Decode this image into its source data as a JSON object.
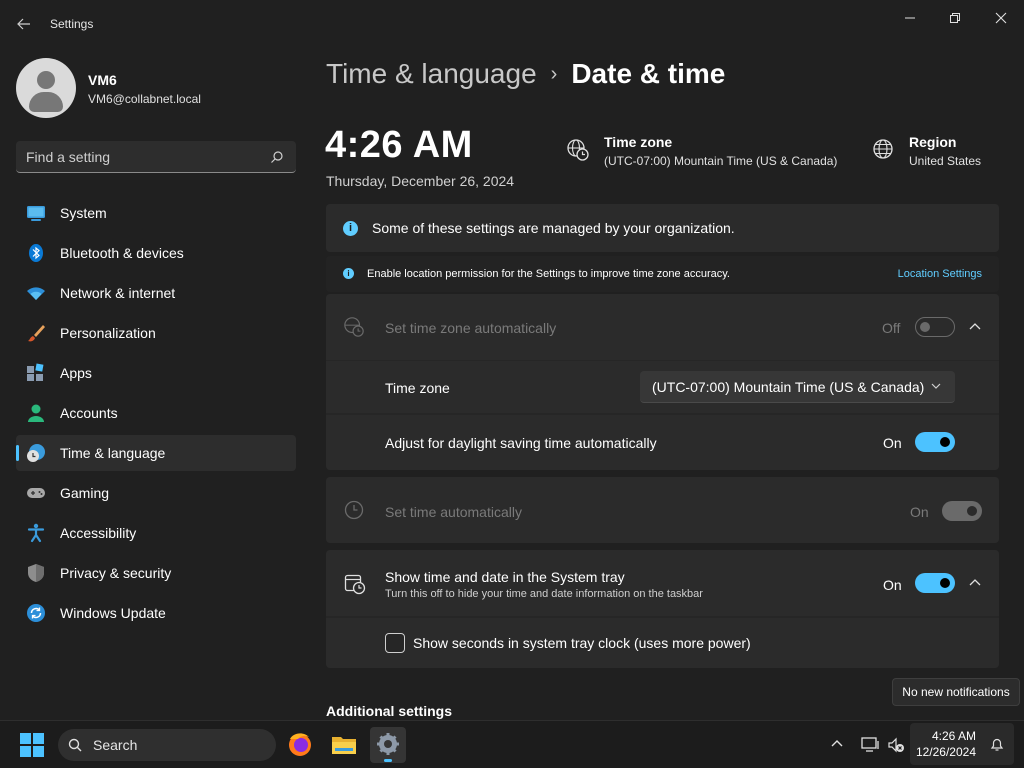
{
  "window": {
    "app_title": "Settings",
    "back_icon": "back-arrow-icon",
    "controls": [
      "minimize-icon",
      "restore-icon",
      "close-icon"
    ]
  },
  "profile": {
    "name": "VM6",
    "email": "VM6@collabnet.local"
  },
  "find": {
    "placeholder": "Find a setting"
  },
  "nav": {
    "items": [
      {
        "label": "System",
        "icon": "system-icon"
      },
      {
        "label": "Bluetooth & devices",
        "icon": "bluetooth-icon"
      },
      {
        "label": "Network & internet",
        "icon": "wifi-icon"
      },
      {
        "label": "Personalization",
        "icon": "brush-icon"
      },
      {
        "label": "Apps",
        "icon": "apps-icon"
      },
      {
        "label": "Accounts",
        "icon": "accounts-icon"
      },
      {
        "label": "Time & language",
        "icon": "time-language-icon",
        "active": true
      },
      {
        "label": "Gaming",
        "icon": "gamepad-icon"
      },
      {
        "label": "Accessibility",
        "icon": "accessibility-icon"
      },
      {
        "label": "Privacy & security",
        "icon": "shield-icon"
      },
      {
        "label": "Windows Update",
        "icon": "update-icon"
      }
    ]
  },
  "page": {
    "breadcrumb_parent": "Time & language",
    "breadcrumb_sep": "›",
    "breadcrumb_current": "Date & time"
  },
  "clock": {
    "time": "4:26 AM",
    "date": "Thursday, December 26, 2024"
  },
  "timezone_summary": {
    "title": "Time zone",
    "value": "(UTC-07:00) Mountain Time (US & Canada)"
  },
  "region_summary": {
    "title": "Region",
    "value": "United States"
  },
  "banners": {
    "managed": "Some of these settings are managed by your organization.",
    "location": "Enable location permission for the Settings to improve time zone accuracy.",
    "location_link": "Location Settings"
  },
  "settings": {
    "tz_auto": {
      "label": "Set time zone automatically",
      "state": "Off"
    },
    "tz": {
      "label": "Time zone",
      "selected": "(UTC-07:00) Mountain Time (US & Canada)"
    },
    "dst": {
      "label": "Adjust for daylight saving time automatically",
      "state": "On"
    },
    "time_auto": {
      "label": "Set time automatically",
      "state": "On"
    },
    "tray": {
      "label": "Show time and date in the System tray",
      "description": "Turn this off to hide your time and date information on the taskbar",
      "state": "On"
    },
    "seconds": {
      "label": "Show seconds in system tray clock (uses more power)",
      "checked": false
    }
  },
  "additional_settings": "Additional settings",
  "tooltip": "No new notifications",
  "taskbar": {
    "search_label": "Search",
    "apps": [
      "firefox-icon",
      "file-explorer-icon",
      "settings-icon"
    ],
    "time": "4:26 AM",
    "date": "12/26/2024"
  },
  "colors": {
    "accent": "#4cc2ff",
    "background": "#202020",
    "card": "#2b2b2b"
  }
}
